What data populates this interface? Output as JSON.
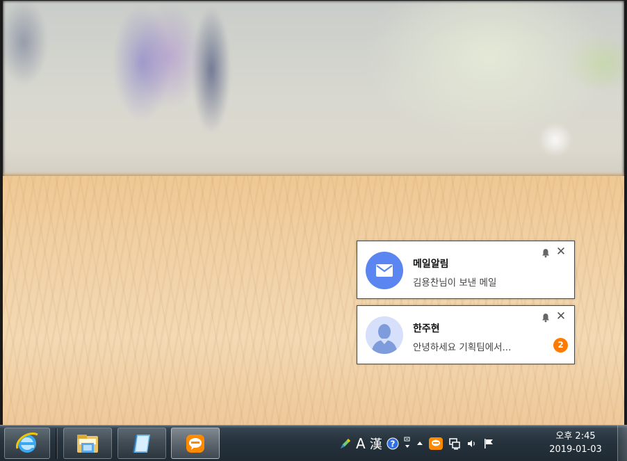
{
  "notifications": [
    {
      "title": "메일알림",
      "message": "김용찬님이 보낸 메일",
      "icon": "mail-icon",
      "badge": null
    },
    {
      "title": "한주현",
      "message": "안녕하세요 기획팀에서...",
      "icon": "person-avatar",
      "badge": "2"
    }
  ],
  "taskbar": {
    "pinned": [
      "internet-explorer-icon",
      "file-explorer-icon",
      "notepad-icon",
      "kakaotalk-icon"
    ],
    "tray": {
      "ime_mode": "A",
      "ime_hanja": "漢",
      "icons": [
        "ime-pen-icon",
        "help-icon",
        "ime-options-icon",
        "show-hidden-icons",
        "kakaotalk-tray-icon",
        "network-icon",
        "volume-icon",
        "action-center-flag-icon"
      ]
    },
    "clock": {
      "time": "오후 2:45",
      "date": "2019-01-03"
    }
  },
  "colors": {
    "mail_accent": "#5b85f0",
    "badge": "#ff7a00",
    "kakao_orange": "#ff8a00"
  }
}
